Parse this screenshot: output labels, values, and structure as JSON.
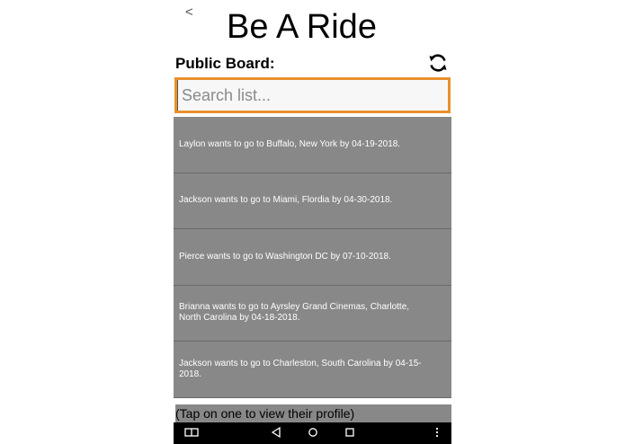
{
  "header": {
    "back_label": "<",
    "app_title": "Be A Ride"
  },
  "board": {
    "label": "Public Board:",
    "refresh_icon": "refresh-icon"
  },
  "search": {
    "placeholder": "Search list...",
    "value": ""
  },
  "rides": [
    "Laylon wants to go to Buffalo, New York by 04-19-2018.",
    "Jackson wants to go to Miami, Flordia by 04-30-2018.",
    "Pierce wants to go to Washington DC by 07-10-2018.",
    "Brianna wants to go to Ayrsley Grand Cinemas, Charlotte, North Carolina by 04-18-2018.",
    "Jackson wants to go to Charleston, South Carolina by 04-15-2018."
  ],
  "hint": "(Tap on one to view their profile)",
  "navbar": {
    "icons": [
      "overview-icon",
      "back-triangle-icon",
      "home-circle-icon",
      "recents-square-icon",
      "menu-dots-icon"
    ]
  },
  "colors": {
    "accent": "#e8912c",
    "list_bg": "#888888",
    "nav_bg": "#000000"
  }
}
